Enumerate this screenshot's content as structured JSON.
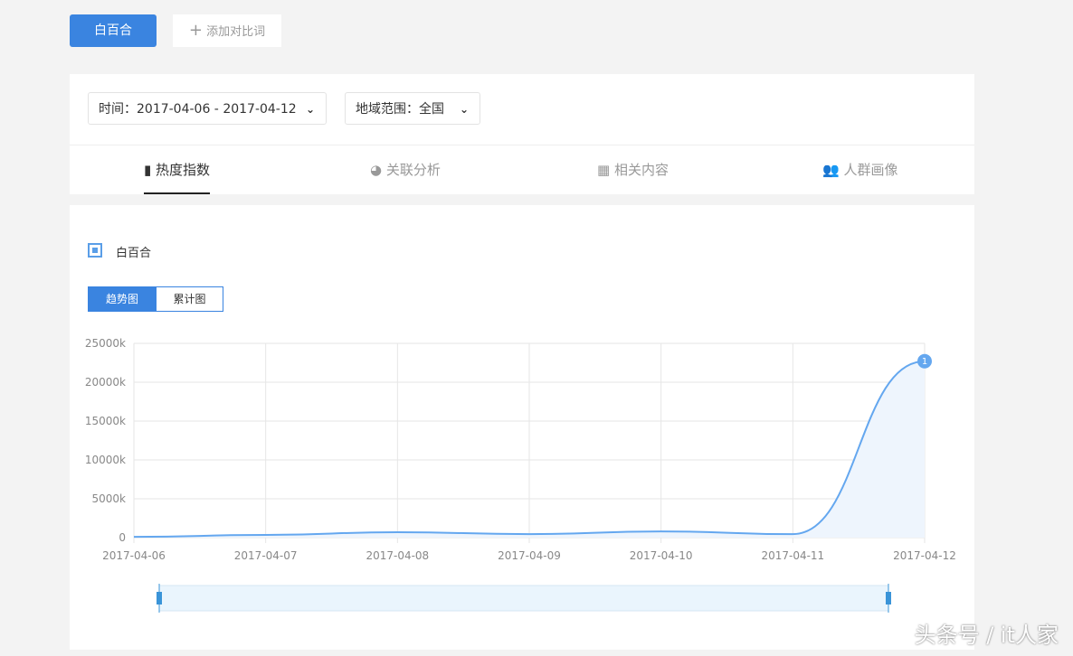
{
  "top": {
    "keyword": "白百合",
    "add_label": "添加对比词",
    "add_icon": "plus-icon"
  },
  "filters": {
    "time": "时间：2017-04-06 - 2017-04-12",
    "region": "地域范围：全国"
  },
  "tabs": [
    {
      "label": "热度指数",
      "icon": "bar-chart-icon",
      "active": true
    },
    {
      "label": "关联分析",
      "icon": "pie-chart-icon"
    },
    {
      "label": "相关内容",
      "icon": "grid-icon"
    },
    {
      "label": "人群画像",
      "icon": "users-icon"
    }
  ],
  "legend": {
    "label": "白百合"
  },
  "view": {
    "trend": "趋势图",
    "cumulative": "累计图",
    "active": "趋势图"
  },
  "watermark": "头条号 / it人家",
  "colors": {
    "accent": "#3a84e0",
    "line": "#64a7ef",
    "area": "#eef5fd"
  },
  "chart_data": {
    "type": "area",
    "categories": [
      "2017-04-06",
      "2017-04-07",
      "2017-04-08",
      "2017-04-09",
      "2017-04-10",
      "2017-04-11",
      "2017-04-12"
    ],
    "series": [
      {
        "name": "白百合",
        "values": [
          100,
          350,
          700,
          450,
          800,
          450,
          22700
        ]
      }
    ],
    "unit": "k",
    "ylim": [
      0,
      25000
    ],
    "yticks": [
      "0",
      "5000k",
      "10000k",
      "15000k",
      "20000k",
      "25000k"
    ],
    "grid": true,
    "marker_label": "1"
  }
}
